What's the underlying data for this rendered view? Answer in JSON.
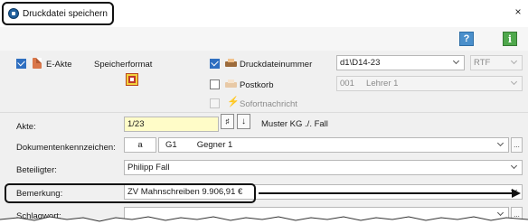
{
  "window": {
    "title": "Druckdatei speichern",
    "close_label": "×",
    "help_label": "?",
    "info_label": "i"
  },
  "options": {
    "eakte_label": "E-Akte",
    "speicherformat_label": "Speicherformat",
    "druckdateinummer_label": "Druckdateinummer",
    "druckdateinummer_value": "d1\\D14-23",
    "format_value": "RTF",
    "postkorb_label": "Postkorb",
    "postkorb_value": "001     Lehrer 1",
    "sofortnachricht_label": "Sofortnachricht"
  },
  "form": {
    "akte_label": "Akte:",
    "akte_value": "1/23",
    "akte_btn1": "♯",
    "akte_btn2": "↓",
    "akte_caption": "Muster KG ./. Fall",
    "dokumentenkennzeichen_label": "Dokumentenkennzeichen:",
    "dk_code": "a",
    "dk_party_code": "G1",
    "dk_party_name": "Gegner 1",
    "beteiligter_label": "Beteiligter:",
    "beteiligter_value": "Philipp Fall",
    "bemerkung_label": "Bemerkung:",
    "bemerkung_value": "ZV Mahnschreiben 9.906,91 €",
    "schlagwort_label": "Schlagwort:",
    "ellipsis": "..."
  },
  "colors": {
    "accent_checkbox": "#2f6fc0",
    "akte_field_bg": "#fffcc8",
    "help_button": "#4a8fcb",
    "info_button": "#4fa84c"
  }
}
